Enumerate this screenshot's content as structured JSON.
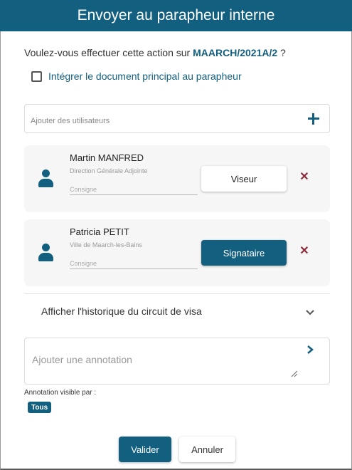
{
  "dialog": {
    "title": "Envoyer au parapheur interne",
    "question_prefix": "Voulez-vous effectuer cette action sur ",
    "document_ref": "MAARCH/2021A/2",
    "question_suffix": " ?",
    "include_main_document_label": "Intégrer le document principal au parapheur",
    "include_main_document_checked": false
  },
  "users_search": {
    "placeholder": "Ajouter des utilisateurs",
    "add_icon": "plus-icon"
  },
  "workflow": [
    {
      "name": "Martin MANFRED",
      "entity": "Direction Générale Adjointe",
      "consigne_placeholder": "Consigne",
      "role": "Viseur",
      "person_icon": "person-icon",
      "remove_icon": "close-icon"
    },
    {
      "name": "Patricia PETIT",
      "entity": "Ville de Maarch-les-Bains",
      "consigne_placeholder": "Consigne",
      "role": "Signataire",
      "person_icon": "person-icon",
      "remove_icon": "close-icon"
    }
  ],
  "history": {
    "label": "Afficher l'historique du circuit de visa",
    "expand_icon": "chevron-down-icon"
  },
  "annotation": {
    "placeholder": "Ajouter une annotation",
    "send_icon": "chevron-right-icon",
    "visibility_label": "Annotation visible par :",
    "visibility_badge": "Tous"
  },
  "actions": {
    "submit_label": "Valider",
    "cancel_label": "Annuler"
  },
  "colors": {
    "primary": "#135f7f",
    "remove": "#8b2a3a"
  }
}
